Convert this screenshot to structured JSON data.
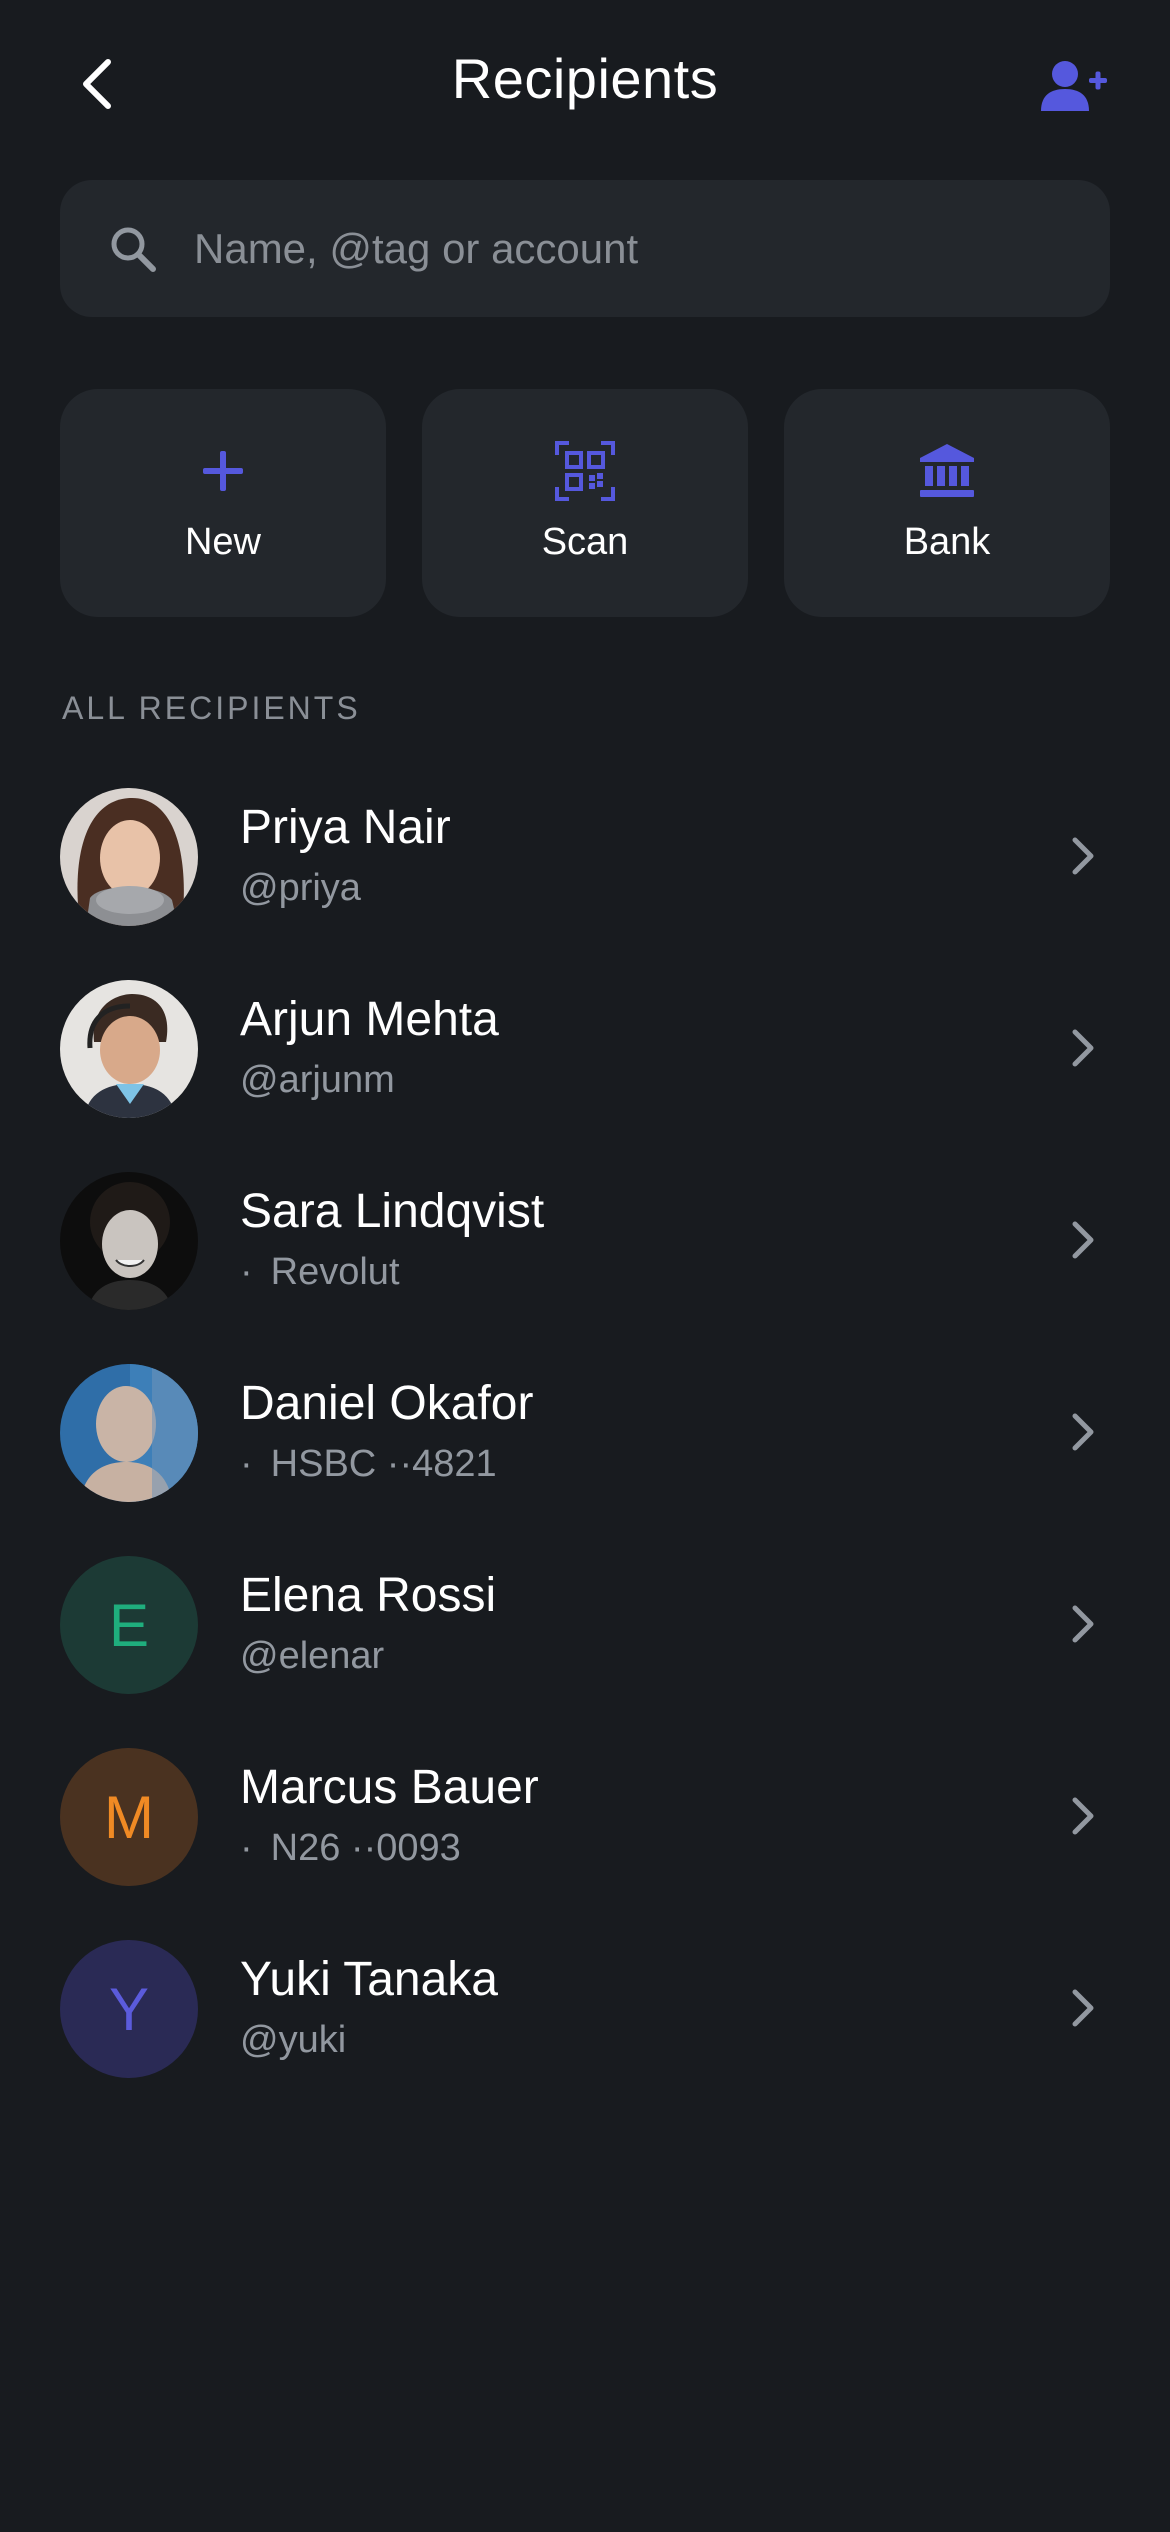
{
  "header": {
    "title": "Recipients",
    "back_icon": "chevron-left-icon",
    "add_icon": "add-person-icon"
  },
  "search": {
    "placeholder": "Name, @tag or account",
    "value": "",
    "icon": "search-icon"
  },
  "actions": [
    {
      "label": "New",
      "icon": "plus-icon"
    },
    {
      "label": "Scan",
      "icon": "qr-code-icon"
    },
    {
      "label": "Bank",
      "icon": "bank-icon"
    }
  ],
  "section_label": "ALL RECIPIENTS",
  "recipients": [
    {
      "name": "Priya Nair",
      "sub": "@priya",
      "avatar": "photo"
    },
    {
      "name": "Arjun Mehta",
      "sub": "@arjunm",
      "avatar": "photo"
    },
    {
      "name": "Sara Lindqvist",
      "bullet": "·",
      "sub": "Revolut",
      "avatar": "photo"
    },
    {
      "name": "Daniel Okafor",
      "bullet": "·",
      "sub": "HSBC ··4821",
      "avatar": "photo"
    },
    {
      "name": "Elena Rossi",
      "sub": "@elenar",
      "initial": "E",
      "avatar_bg": "#1c3a35",
      "avatar_fg": "#1fae7d"
    },
    {
      "name": "Marcus Bauer",
      "bullet": "·",
      "sub": "N26 ··0093",
      "initial": "M",
      "avatar_bg": "#4a3220",
      "avatar_fg": "#f08a24"
    },
    {
      "name": "Yuki Tanaka",
      "sub": "@yuki",
      "initial": "Y",
      "avatar_bg": "#2a2a55",
      "avatar_fg": "#5b5bdc"
    }
  ],
  "colors": {
    "accent": "#5558dd",
    "background": "#181b1f",
    "card": "#23272c",
    "muted_text": "#8a8f96"
  }
}
